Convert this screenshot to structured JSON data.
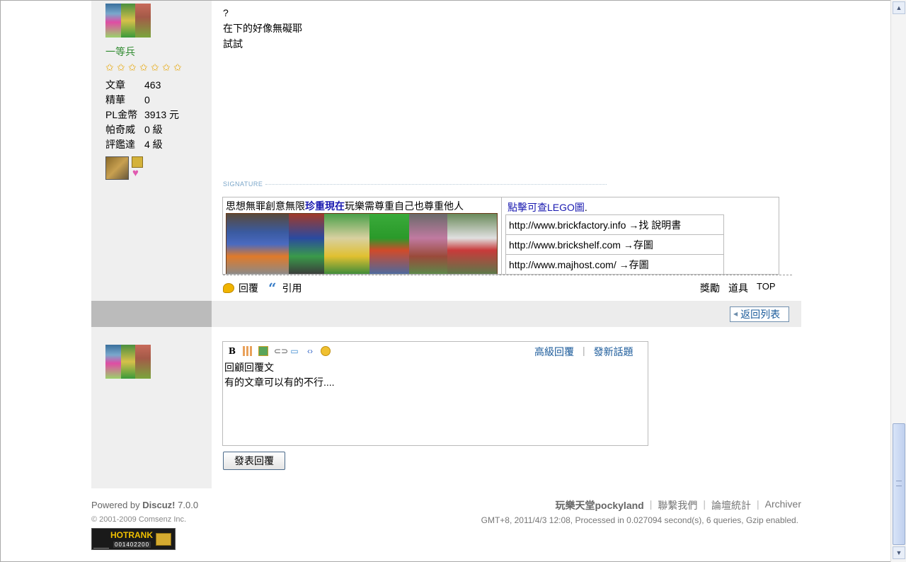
{
  "post": {
    "rank": "一等兵",
    "stats": [
      {
        "label": "文章",
        "value": "463"
      },
      {
        "label": "精華",
        "value": "0"
      },
      {
        "label": "PL金幣",
        "value": "3913 元"
      },
      {
        "label": "帕奇威",
        "value": "0 級"
      },
      {
        "label": "評鑑達",
        "value": "4 級"
      }
    ],
    "stars": 7,
    "content": [
      "?",
      "在下的好像無礙耶",
      "試試"
    ],
    "signature_label": "SIGNATURE",
    "sig_motto_pre": "思想無罪創意無限",
    "sig_motto_bold": "珍重現在",
    "sig_motto_post": "玩樂需尊重自己也尊重他人",
    "sig_click": "點擊可查LEGO圖",
    "sig_click_dot": ".",
    "sig_links": [
      "http://www.brickfactory.info →找 說明書",
      "http://www.brickshelf.com →存圖",
      "http://www.majhost.com/  →存圖"
    ],
    "actions": {
      "reply": "回覆",
      "quote": "引用"
    },
    "right_actions": {
      "reward": "獎勵",
      "tools": "道具",
      "top": "TOP"
    }
  },
  "bar": {
    "back": "返回列表"
  },
  "reply": {
    "adv_reply": "高級回覆",
    "new_topic": "發新話題",
    "sep": "|",
    "text_lines": [
      "回顧回覆文",
      "有的文章可以有的不行...."
    ],
    "submit": "發表回覆"
  },
  "footer": {
    "powered_pre": "Powered by",
    "powered_brand": "Discuz!",
    "powered_ver": "7.0.0",
    "copyright": "© 2001-2009 Comsenz Inc.",
    "hotrank": "HOTRANK",
    "hotrank_num": "001402200",
    "site": "玩樂天堂pockyland",
    "contact": "聯繫我們",
    "stats": "論壇統計",
    "archiver": "Archiver",
    "info": "GMT+8, 2011/4/3 12:08, Processed in 0.027094 second(s), 6 queries, Gzip enabled."
  },
  "colors": {
    "accent": "#1a5a9a",
    "rank": "#2f8a2f",
    "sidebar": "#efefef"
  }
}
